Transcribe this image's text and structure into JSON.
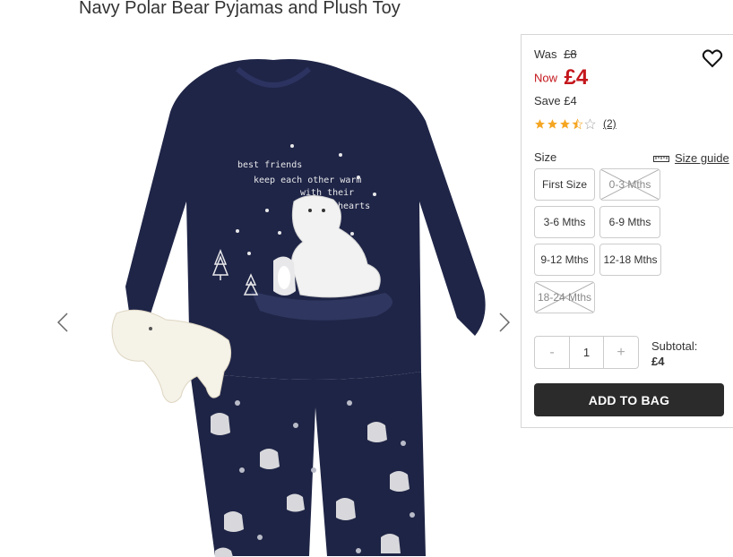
{
  "product": {
    "title": "Navy Polar Bear Pyjamas and Plush Toy",
    "image_text": [
      "best friends",
      "keep each other warm",
      "with their",
      "hearts"
    ]
  },
  "price": {
    "was_label": "Was",
    "was_value": "£8",
    "now_label": "Now",
    "now_value": "£4",
    "save_label": "Save",
    "save_value": "£4",
    "sale_color": "#c4161c"
  },
  "rating": {
    "stars": 3.5,
    "max": 5,
    "count": "(2)",
    "star_color": "#f5a623"
  },
  "size": {
    "label": "Size",
    "guide_label": "Size guide",
    "options": [
      {
        "label": "First Size",
        "available": true
      },
      {
        "label": "0-3 Mths",
        "available": false
      },
      {
        "label": "3-6 Mths",
        "available": true
      },
      {
        "label": "6-9 Mths",
        "available": true
      },
      {
        "label": "9-12 Mths",
        "available": true
      },
      {
        "label": "12-18 Mths",
        "available": true
      },
      {
        "label": "18-24 Mths",
        "available": false
      }
    ]
  },
  "quantity": {
    "minus": "-",
    "value": "1",
    "plus": "+"
  },
  "subtotal": {
    "label": "Subtotal:",
    "value": "£4"
  },
  "cta": {
    "add_to_bag": "ADD TO BAG"
  }
}
